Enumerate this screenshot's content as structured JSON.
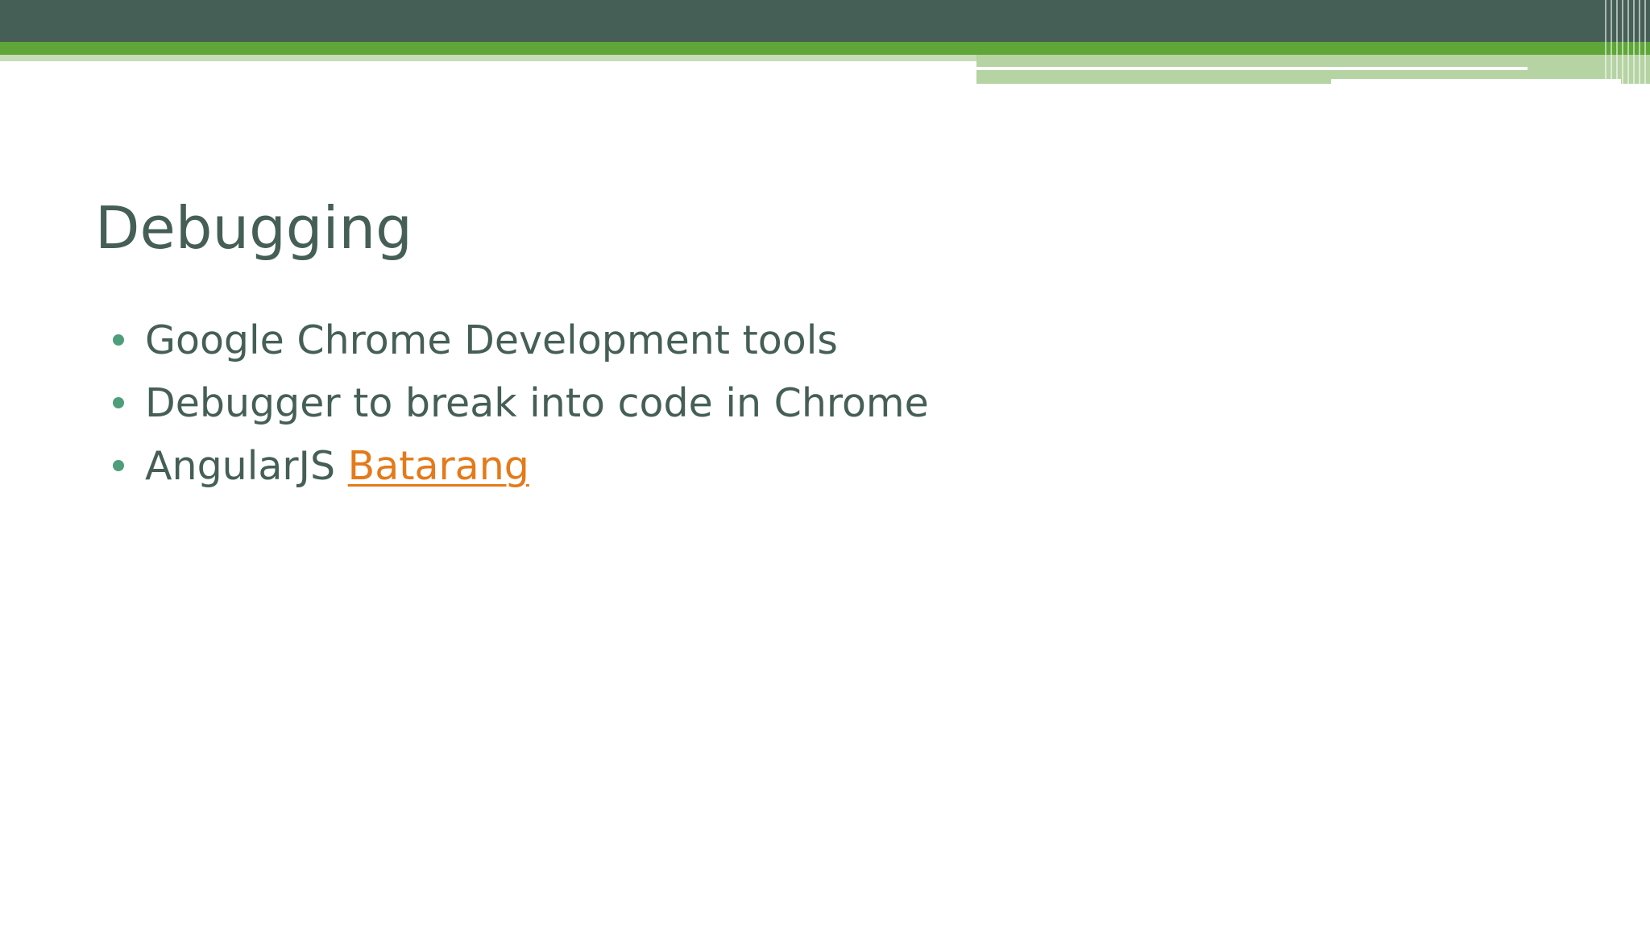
{
  "slide": {
    "title": "Debugging",
    "bullets": [
      {
        "text": "Google Chrome Development tools"
      },
      {
        "text": "Debugger to break into code in Chrome"
      },
      {
        "text": "AngularJS",
        "link_text": "Batarang"
      }
    ]
  },
  "theme": {
    "dark_band": "#455f56",
    "accent_green": "#5ea637",
    "light_green": "#b5d3a3",
    "bullet_color": "#4e9e7c",
    "text_color": "#455f56",
    "link_color": "#e47a1a"
  }
}
